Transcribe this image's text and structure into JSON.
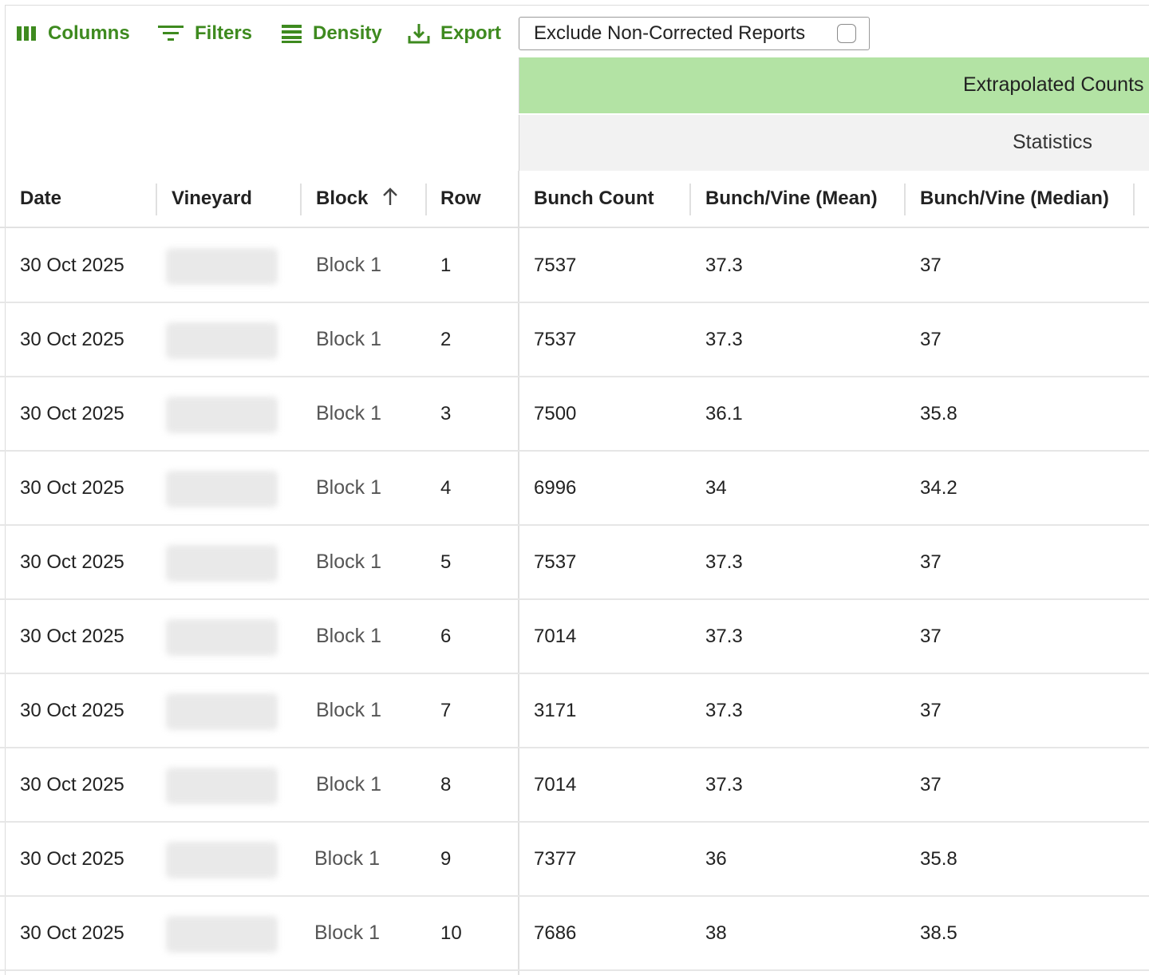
{
  "toolbar": {
    "columns_label": "Columns",
    "filters_label": "Filters",
    "density_label": "Density",
    "export_label": "Export",
    "exclude_label": "Exclude Non-Corrected Reports",
    "exclude_checked": false
  },
  "group_headers": {
    "extrapolated_counts": "Extrapolated Counts",
    "statistics": "Statistics"
  },
  "columns": {
    "date": "Date",
    "vineyard": "Vineyard",
    "block": "Block",
    "row": "Row",
    "bunch_count": "Bunch Count",
    "bunch_vine_mean": "Bunch/Vine (Mean)",
    "bunch_vine_median": "Bunch/Vine (Median)"
  },
  "sort": {
    "column": "block",
    "direction": "ascending"
  },
  "rows": [
    {
      "date": "30 Oct 2025",
      "block": "Block 1",
      "row": "1",
      "bunch_count": "7537",
      "mean": "37.3",
      "median": "37"
    },
    {
      "date": "30 Oct 2025",
      "block": "Block 1",
      "row": "2",
      "bunch_count": "7537",
      "mean": "37.3",
      "median": "37"
    },
    {
      "date": "30 Oct 2025",
      "block": "Block 1",
      "row": "3",
      "bunch_count": "7500",
      "mean": "36.1",
      "median": "35.8"
    },
    {
      "date": "30 Oct 2025",
      "block": "Block 1",
      "row": "4",
      "bunch_count": "6996",
      "mean": "34",
      "median": "34.2"
    },
    {
      "date": "30 Oct 2025",
      "block": "Block 1",
      "row": "5",
      "bunch_count": "7537",
      "mean": "37.3",
      "median": "37"
    },
    {
      "date": "30 Oct 2025",
      "block": "Block 1",
      "row": "6",
      "bunch_count": "7014",
      "mean": "37.3",
      "median": "37"
    },
    {
      "date": "30 Oct 2025",
      "block": "Block 1",
      "row": "7",
      "bunch_count": "3171",
      "mean": "37.3",
      "median": "37"
    },
    {
      "date": "30 Oct 2025",
      "block": "Block 1",
      "row": "8",
      "bunch_count": "7014",
      "mean": "37.3",
      "median": "37"
    },
    {
      "date": "30 Oct 2025",
      "block": "Block 1",
      "row": "9",
      "bunch_count": "7377",
      "mean": "36",
      "median": "35.8"
    },
    {
      "date": "30 Oct 2025",
      "block": "Block 1",
      "row": "10",
      "bunch_count": "7686",
      "mean": "38",
      "median": "38.5"
    }
  ],
  "colors": {
    "accent_green": "#3e8a1f",
    "group_header_green": "#b3e3a4",
    "group_header_grey": "#f2f2f2"
  },
  "icons": [
    "columns-icon",
    "filter-icon",
    "density-icon",
    "export-icon",
    "sort-ascending-icon"
  ]
}
